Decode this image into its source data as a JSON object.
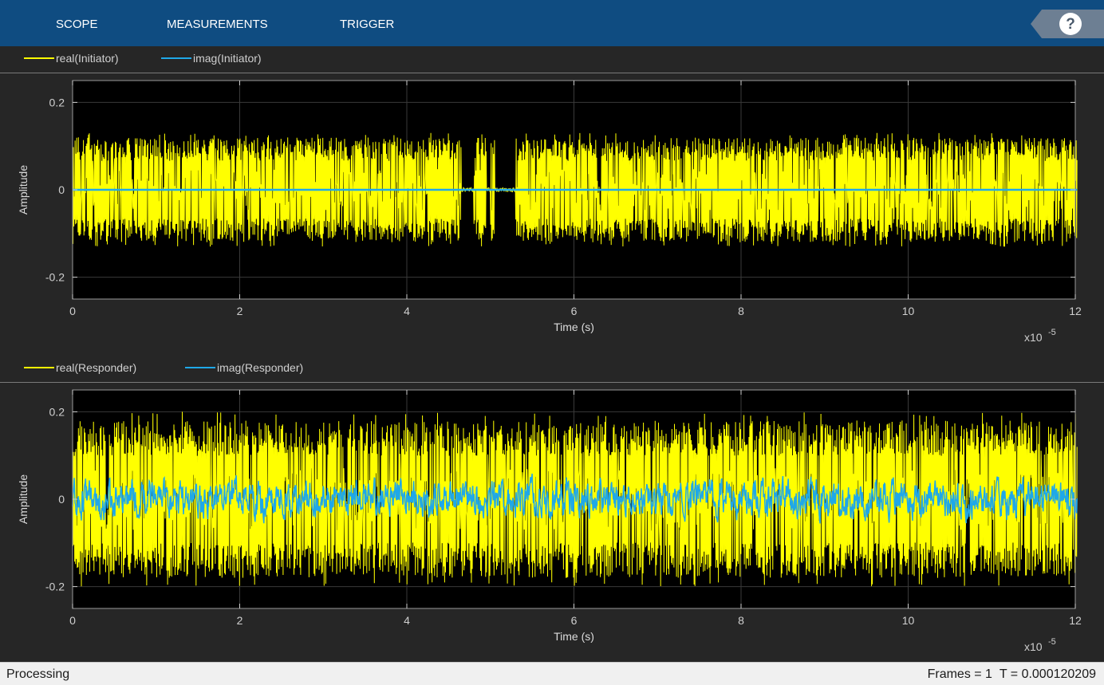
{
  "toolbar": {
    "tabs": [
      "SCOPE",
      "MEASUREMENTS",
      "TRIGGER"
    ],
    "help_icon": "question-mark-icon",
    "help_glyph": "?"
  },
  "colors": {
    "toolbar_bg": "#0f4c81",
    "real_series": "#ffff00",
    "imag_series": "#1fa8e8",
    "plot_bg": "#000000"
  },
  "plots": [
    {
      "legend": [
        "real(Initiator)",
        "imag(Initiator)"
      ],
      "ylabel": "Amplitude",
      "xlabel": "Time (s)",
      "yticks": [
        "0.2",
        "0",
        "-0.2"
      ],
      "xticks": [
        "0",
        "2",
        "4",
        "6",
        "8",
        "10",
        "12"
      ],
      "exponent": "x10",
      "exponent_power": "-5"
    },
    {
      "legend": [
        "real(Responder)",
        "imag(Responder)"
      ],
      "ylabel": "Amplitude",
      "xlabel": "Time (s)",
      "yticks": [
        "0.2",
        "0",
        "-0.2"
      ],
      "xticks": [
        "0",
        "2",
        "4",
        "6",
        "8",
        "10",
        "12"
      ],
      "exponent": "x10",
      "exponent_power": "-5"
    }
  ],
  "chart_data": [
    {
      "type": "line",
      "xlim": [
        0,
        0.00012
      ],
      "ylim": [
        -0.25,
        0.25
      ],
      "x_range": [
        0,
        0.000120209
      ],
      "series": [
        {
          "name": "real(Initiator)",
          "envelope": [
            -0.12,
            0.12
          ],
          "peaks": [
            -0.13,
            0.13
          ],
          "gaps": [
            [
              4.65e-05,
              4.8e-05
            ],
            [
              4.95e-05,
              5e-05
            ],
            [
              5.05e-05,
              5.3e-05
            ]
          ]
        },
        {
          "name": "imag(Initiator)",
          "level": 0
        }
      ],
      "grid": true
    },
    {
      "type": "line",
      "xlim": [
        0,
        0.00012
      ],
      "ylim": [
        -0.25,
        0.25
      ],
      "x_range": [
        0,
        0.000120209
      ],
      "series": [
        {
          "name": "real(Responder)",
          "envelope": [
            -0.18,
            0.18
          ],
          "peaks": [
            -0.2,
            0.2
          ]
        },
        {
          "name": "imag(Responder)",
          "envelope": [
            -0.05,
            0.05
          ]
        }
      ],
      "grid": true
    }
  ],
  "status": {
    "text": "Processing",
    "frames": "Frames = 1",
    "time": "T = 0.000120209"
  }
}
